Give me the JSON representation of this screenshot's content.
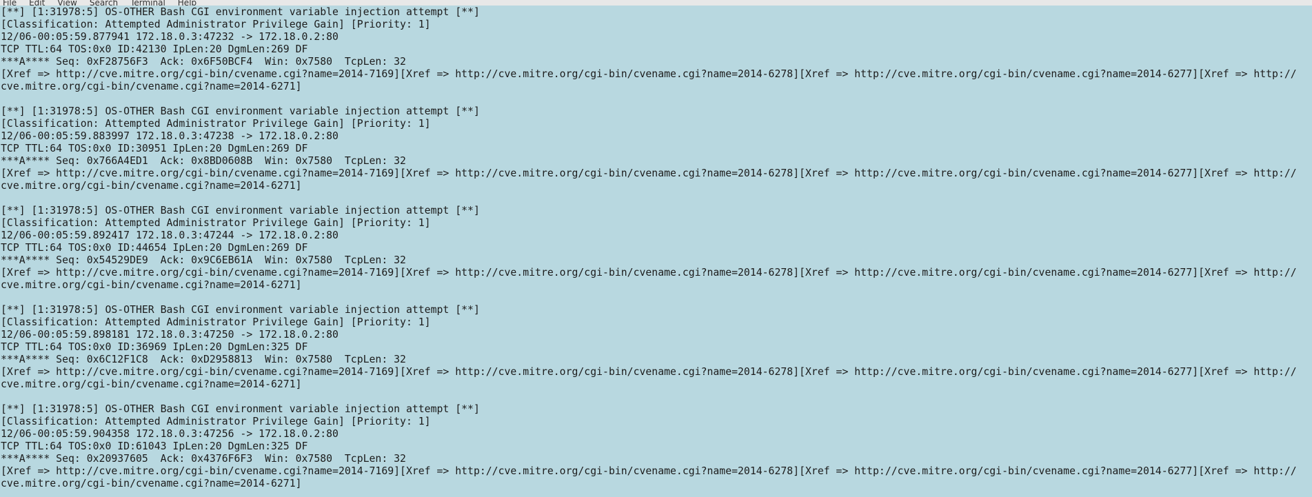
{
  "menubar": {
    "items": [
      "File",
      "Edit",
      "View",
      "Search",
      "Terminal",
      "Help"
    ]
  },
  "alerts": [
    {
      "header": "[**] [1:31978:5] OS-OTHER Bash CGI environment variable injection attempt [**]",
      "classification": "[Classification: Attempted Administrator Privilege Gain] [Priority: 1]",
      "timestamp_line": "12/06-00:05:59.877941 172.18.0.3:47232 -> 172.18.0.2:80",
      "ip_line": "TCP TTL:64 TOS:0x0 ID:42130 IpLen:20 DgmLen:269 DF",
      "tcp_line": "***A**** Seq: 0xF28756F3  Ack: 0x6F50BCF4  Win: 0x7580  TcpLen: 32",
      "xref_line1": "[Xref => http://cve.mitre.org/cgi-bin/cvename.cgi?name=2014-7169][Xref => http://cve.mitre.org/cgi-bin/cvename.cgi?name=2014-6278][Xref => http://cve.mitre.org/cgi-bin/cvename.cgi?name=2014-6277][Xref => http://",
      "xref_line2": "cve.mitre.org/cgi-bin/cvename.cgi?name=2014-6271]"
    },
    {
      "header": "[**] [1:31978:5] OS-OTHER Bash CGI environment variable injection attempt [**]",
      "classification": "[Classification: Attempted Administrator Privilege Gain] [Priority: 1]",
      "timestamp_line": "12/06-00:05:59.883997 172.18.0.3:47238 -> 172.18.0.2:80",
      "ip_line": "TCP TTL:64 TOS:0x0 ID:30951 IpLen:20 DgmLen:269 DF",
      "tcp_line": "***A**** Seq: 0x766A4ED1  Ack: 0x8BD0608B  Win: 0x7580  TcpLen: 32",
      "xref_line1": "[Xref => http://cve.mitre.org/cgi-bin/cvename.cgi?name=2014-7169][Xref => http://cve.mitre.org/cgi-bin/cvename.cgi?name=2014-6278][Xref => http://cve.mitre.org/cgi-bin/cvename.cgi?name=2014-6277][Xref => http://",
      "xref_line2": "cve.mitre.org/cgi-bin/cvename.cgi?name=2014-6271]"
    },
    {
      "header": "[**] [1:31978:5] OS-OTHER Bash CGI environment variable injection attempt [**]",
      "classification": "[Classification: Attempted Administrator Privilege Gain] [Priority: 1]",
      "timestamp_line": "12/06-00:05:59.892417 172.18.0.3:47244 -> 172.18.0.2:80",
      "ip_line": "TCP TTL:64 TOS:0x0 ID:44654 IpLen:20 DgmLen:269 DF",
      "tcp_line": "***A**** Seq: 0x54529DE9  Ack: 0x9C6EB61A  Win: 0x7580  TcpLen: 32",
      "xref_line1": "[Xref => http://cve.mitre.org/cgi-bin/cvename.cgi?name=2014-7169][Xref => http://cve.mitre.org/cgi-bin/cvename.cgi?name=2014-6278][Xref => http://cve.mitre.org/cgi-bin/cvename.cgi?name=2014-6277][Xref => http://",
      "xref_line2": "cve.mitre.org/cgi-bin/cvename.cgi?name=2014-6271]"
    },
    {
      "header": "[**] [1:31978:5] OS-OTHER Bash CGI environment variable injection attempt [**]",
      "classification": "[Classification: Attempted Administrator Privilege Gain] [Priority: 1]",
      "timestamp_line": "12/06-00:05:59.898181 172.18.0.3:47250 -> 172.18.0.2:80",
      "ip_line": "TCP TTL:64 TOS:0x0 ID:36969 IpLen:20 DgmLen:325 DF",
      "tcp_line": "***A**** Seq: 0x6C12F1C8  Ack: 0xD2958813  Win: 0x7580  TcpLen: 32",
      "xref_line1": "[Xref => http://cve.mitre.org/cgi-bin/cvename.cgi?name=2014-7169][Xref => http://cve.mitre.org/cgi-bin/cvename.cgi?name=2014-6278][Xref => http://cve.mitre.org/cgi-bin/cvename.cgi?name=2014-6277][Xref => http://",
      "xref_line2": "cve.mitre.org/cgi-bin/cvename.cgi?name=2014-6271]"
    },
    {
      "header": "[**] [1:31978:5] OS-OTHER Bash CGI environment variable injection attempt [**]",
      "classification": "[Classification: Attempted Administrator Privilege Gain] [Priority: 1]",
      "timestamp_line": "12/06-00:05:59.904358 172.18.0.3:47256 -> 172.18.0.2:80",
      "ip_line": "TCP TTL:64 TOS:0x0 ID:61043 IpLen:20 DgmLen:325 DF",
      "tcp_line": "***A**** Seq: 0x20937605  Ack: 0x4376F6F3  Win: 0x7580  TcpLen: 32",
      "xref_line1": "[Xref => http://cve.mitre.org/cgi-bin/cvename.cgi?name=2014-7169][Xref => http://cve.mitre.org/cgi-bin/cvename.cgi?name=2014-6278][Xref => http://cve.mitre.org/cgi-bin/cvename.cgi?name=2014-6277][Xref => http://",
      "xref_line2": "cve.mitre.org/cgi-bin/cvename.cgi?name=2014-6271]"
    }
  ]
}
